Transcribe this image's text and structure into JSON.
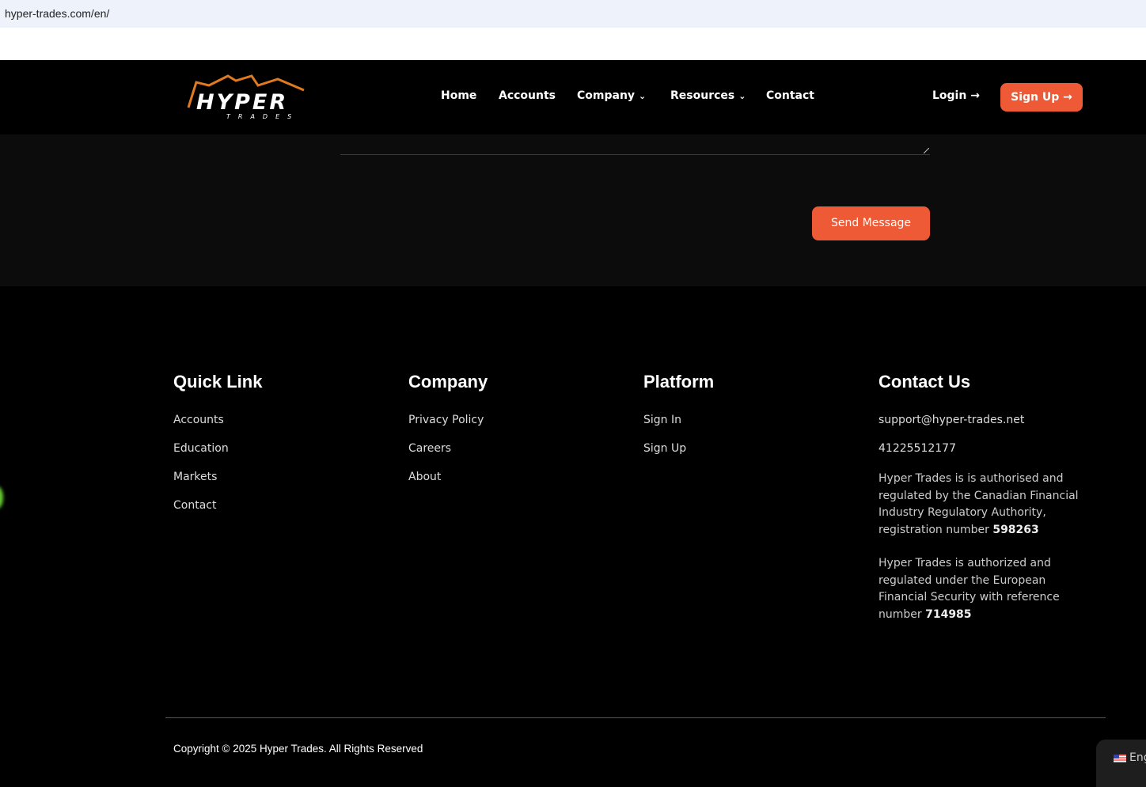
{
  "browser": {
    "url": "hyper-trades.com/en/"
  },
  "header": {
    "logo_text": "HYPER",
    "logo_sub": "TRADES",
    "nav": [
      "Home",
      "Accounts",
      "Company",
      "Resources",
      "Contact"
    ],
    "login": "Login →",
    "signup": "Sign Up →"
  },
  "form": {
    "send": "Send Message"
  },
  "footer": {
    "quick": {
      "title": "Quick Link",
      "items": [
        "Accounts",
        "Education",
        "Markets",
        "Contact"
      ]
    },
    "company": {
      "title": "Company",
      "items": [
        "Privacy Policy",
        "Careers",
        "About"
      ]
    },
    "platform": {
      "title": "Platform",
      "items": [
        "Sign In",
        "Sign Up"
      ]
    },
    "contact": {
      "title": "Contact Us",
      "email": "support@hyper-trades.net",
      "phone": "41225512177",
      "reg1": "Hyper Trades is is authorised and regulated by the Canadian Financial Industry Regulatory Authority, registration number ",
      "reg1_num": "598263",
      "reg2": "Hyper Trades is authorized and regulated under the European Financial Security with reference number ",
      "reg2_num": "714985"
    },
    "copyright": "Copyright © 2025 Hyper Trades. All Rights Reserved"
  },
  "language": {
    "label": "Eng"
  },
  "colors": {
    "accent": "#ee5a36",
    "logo_orange": "#e07a20"
  }
}
